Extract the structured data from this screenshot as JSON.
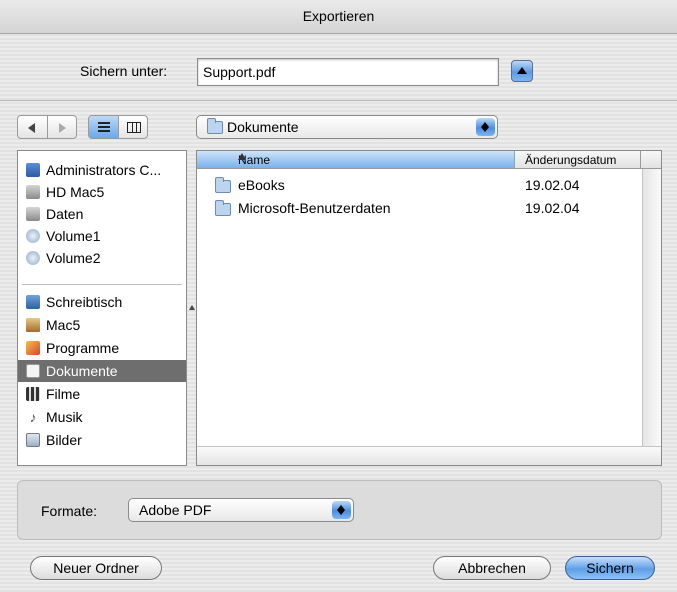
{
  "window": {
    "title": "Exportieren"
  },
  "save": {
    "label": "Sichern unter:",
    "filename": "Support.pdf"
  },
  "location": {
    "selected": "Dokumente"
  },
  "sidebar": {
    "devices": [
      {
        "label": "Administrators C...",
        "icon": "network-disk-icon"
      },
      {
        "label": "HD Mac5",
        "icon": "hard-disk-icon"
      },
      {
        "label": "Daten",
        "icon": "hard-disk-icon"
      },
      {
        "label": "Volume1",
        "icon": "volume-icon"
      },
      {
        "label": "Volume2",
        "icon": "volume-icon"
      }
    ],
    "places": [
      {
        "label": "Schreibtisch",
        "icon": "desktop-icon"
      },
      {
        "label": "Mac5",
        "icon": "home-icon"
      },
      {
        "label": "Programme",
        "icon": "applications-icon"
      },
      {
        "label": "Dokumente",
        "icon": "documents-icon",
        "selected": true
      },
      {
        "label": "Filme",
        "icon": "movies-icon"
      },
      {
        "label": "Musik",
        "icon": "music-icon"
      },
      {
        "label": "Bilder",
        "icon": "pictures-icon"
      }
    ]
  },
  "filelist": {
    "columns": [
      "Name",
      "Änderungsdatum"
    ],
    "rows": [
      {
        "name": "eBooks",
        "date": "19.02.04"
      },
      {
        "name": "Microsoft-Benutzerdaten",
        "date": "19.02.04"
      }
    ]
  },
  "format": {
    "label": "Formate:",
    "selected": "Adobe PDF"
  },
  "buttons": {
    "new_folder": "Neuer Ordner",
    "cancel": "Abbrechen",
    "save": "Sichern"
  },
  "colors": {
    "accent": "#5c9be4",
    "selection": "#6e6e6e"
  }
}
